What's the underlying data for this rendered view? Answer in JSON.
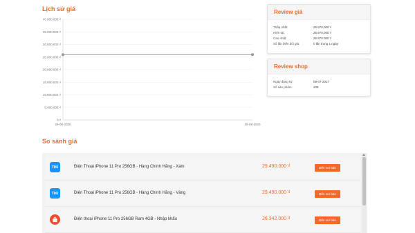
{
  "history": {
    "title": "Lịch sử giá"
  },
  "chart_data": {
    "type": "line",
    "title": "",
    "xlabel": "",
    "ylabel": "",
    "y_ticks": [
      "0 ₫",
      "5.000.000 ₫",
      "10.000.000 ₫",
      "15.000.000 ₫",
      "20.000.000 ₫",
      "25.000.000 ₫",
      "30.000.000 ₫",
      "35.000.000 ₫",
      "40.000.000 ₫"
    ],
    "ylim": [
      0,
      40000000
    ],
    "x_ticks": [
      "29-08-2020",
      "26-08-2020"
    ],
    "series": [
      {
        "x": [
          "29-08-2020",
          "26-08-2020"
        ],
        "values": [
          25970000,
          25970000
        ],
        "color": "#999999"
      }
    ],
    "grid": true
  },
  "review_price": {
    "title": "Review giá",
    "rows": [
      {
        "label": "Thấp nhất:",
        "value": "25.970.000 ₫"
      },
      {
        "label": "Hiện tại:",
        "value": "25.970.000 ₫"
      },
      {
        "label": "Cao nhất:",
        "value": "25.970.000 ₫"
      },
      {
        "label": "Số lần biến đổi giá:",
        "value": "0 lần trong 1 ngày"
      }
    ]
  },
  "review_shop": {
    "title": "Review shop",
    "rows": [
      {
        "label": "Ngày đăng ký:",
        "value": "08-07-2017"
      },
      {
        "label": "Số sản phẩm:",
        "value": "208"
      }
    ]
  },
  "compare": {
    "title": "So sánh giá",
    "items": [
      {
        "shop": "TIKI",
        "name": "Điện Thoại iPhone 11 Pro 256GB - Hàng Chính Hãng - Xám",
        "price": "29.490.000 ₫",
        "button": "Đến nơi bán"
      },
      {
        "shop": "TIKI",
        "name": "Điện Thoại iPhone 11 Pro 256GB - Hàng Chính Hãng - Vàng",
        "price": "29.490.000 ₫",
        "button": "Đến nơi bán"
      },
      {
        "shop": "",
        "name": "Điện thoại iPhone 11 Pro 256GB Ram 4GB - Nhập khẩu",
        "price": "26.342.000 ₫",
        "button": "Đến nơi bán"
      }
    ]
  }
}
